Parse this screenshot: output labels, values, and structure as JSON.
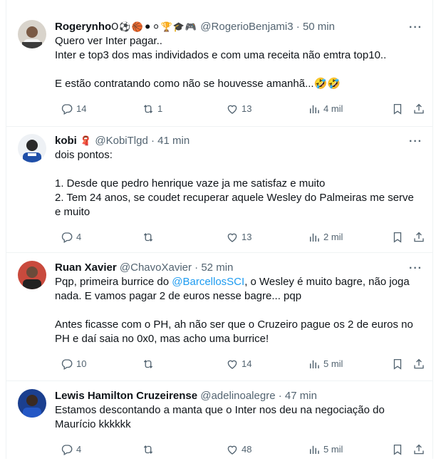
{
  "tweets": [
    {
      "name": "Rogerynho",
      "badges": "O⚽🏀⚫⚪🏆🎓🎮",
      "handle": "@RogerioBenjami3",
      "time": "50 min",
      "lines": [
        "Quero ver Inter pagar..",
        "Inter e top3 dos mas individados e com uma receita não emtra top10..",
        "",
        "E estão contratando como não se houvesse amanhã...🤣🤣"
      ],
      "replies": "14",
      "retweets": "1",
      "likes": "13",
      "views": "4 mil"
    },
    {
      "name": "kobi",
      "badges": "🧣",
      "handle": "@KobiTlgd",
      "time": "41 min",
      "lines": [
        "dois pontos:",
        "",
        "1. Desde que pedro henrique vaze ja me satisfaz e muito",
        "2. Tem 24 anos, se coudet recuperar aquele Wesley do Palmeiras me serve",
        "e muito"
      ],
      "replies": "4",
      "retweets": "",
      "likes": "13",
      "views": "2 mil"
    },
    {
      "name": "Ruan Xavier",
      "badges": "",
      "handle": "@ChavoXavier",
      "time": "52 min",
      "line1_pre": "Pqp, primeira burrice do ",
      "mention": "@BarcellosSCI",
      "line1_post": ", o Wesley é muito bagre, não joga",
      "lines": [
        "nada. E vamos pagar 2 de euros nesse bagre... pqp",
        "",
        "Antes ficasse com o PH, ah não ser que o Cruzeiro pague os 2 de euros no",
        "PH e daí saia no 0x0, mas acho uma burrice!"
      ],
      "replies": "10",
      "retweets": "",
      "likes": "14",
      "views": "5 mil"
    },
    {
      "name": "Lewis Hamilton Cruzeirense",
      "badges": "",
      "handle": "@adelinoalegre",
      "time": "47 min",
      "lines": [
        "Estamos descontando a manta que o Inter nos deu na negociação do",
        "Maurício kkkkkk"
      ],
      "replies": "4",
      "retweets": "",
      "likes": "48",
      "views": "5 mil"
    }
  ],
  "colors": {
    "link": "#1d9bf0",
    "secondary": "#536471",
    "text": "#0f1419"
  },
  "icons": [
    "reply-icon",
    "retweet-icon",
    "like-icon",
    "views-icon",
    "bookmark-icon",
    "share-icon",
    "more-icon"
  ]
}
